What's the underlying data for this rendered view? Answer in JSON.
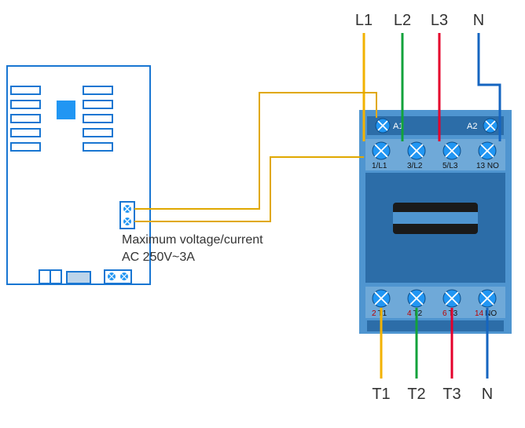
{
  "labels": {
    "top": {
      "l1": "L1",
      "l2": "L2",
      "l3": "L3",
      "n": "N"
    },
    "bottom": {
      "t1": "T1",
      "t2": "T2",
      "t3": "T3",
      "n": "N"
    }
  },
  "contactor": {
    "coil": {
      "a1": "A1",
      "a2": "A2"
    },
    "top_terminals": {
      "t1": "1/L1",
      "t2": "3/L2",
      "t3": "5/L3",
      "t4": "13 NO"
    },
    "bottom_terminals": {
      "t1_num": "2",
      "t1": "T1",
      "t2_num": "4",
      "t2": "T2",
      "t3_num": "6",
      "t3": "T3",
      "t4_num": "14",
      "t4": "NO"
    }
  },
  "note_line1": "Maximum voltage/current",
  "note_line2": "AC 250V~3A",
  "colors": {
    "blue_body": "#4f95d0",
    "blue_dark": "#2c6da8",
    "screw": "#2196f3",
    "l1": "#f2b200",
    "l2": "#12a23b",
    "l3": "#e4002b",
    "n": "#1565c0",
    "coil_wire": "#e0a800",
    "pcb_line": "#1976d2",
    "pcb_fill": "#ffffff",
    "pcb_chip": "#2196f3"
  }
}
